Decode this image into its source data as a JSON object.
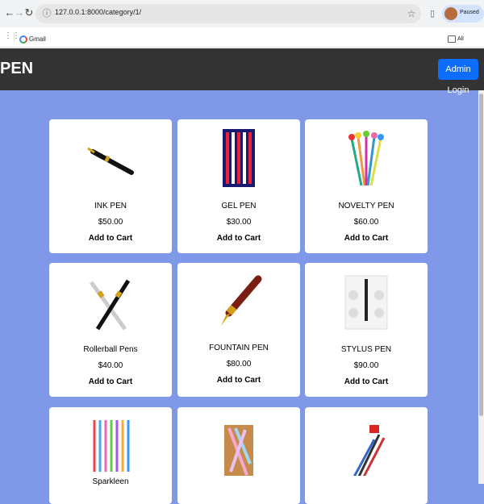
{
  "browser": {
    "url": "127.0.0.1:8000/category/1/",
    "profile_status": "Paused",
    "bookmarks": [
      {
        "label": "Gmail"
      },
      {
        "label": "All Bookmarks"
      }
    ]
  },
  "site": {
    "brand": "PEN",
    "admin_label": "Admin Login"
  },
  "products": [
    {
      "name": "INK PEN",
      "price": "$50.00",
      "cart": "Add to Cart"
    },
    {
      "name": "GEL PEN",
      "price": "$30.00",
      "cart": "Add to Cart"
    },
    {
      "name": "NOVELTY PEN",
      "price": "$60.00",
      "cart": "Add to Cart"
    },
    {
      "name": "Rollerball Pens",
      "price": "$40.00",
      "cart": "Add to Cart"
    },
    {
      "name": "FOUNTAIN PEN",
      "price": "$80.00",
      "cart": "Add to Cart"
    },
    {
      "name": "STYLUS PEN",
      "price": "$90.00",
      "cart": "Add to Cart"
    },
    {
      "name": "Sparkleen",
      "price": "",
      "cart": ""
    },
    {
      "name": "",
      "price": "",
      "cart": ""
    },
    {
      "name": "",
      "price": "",
      "cart": ""
    }
  ]
}
